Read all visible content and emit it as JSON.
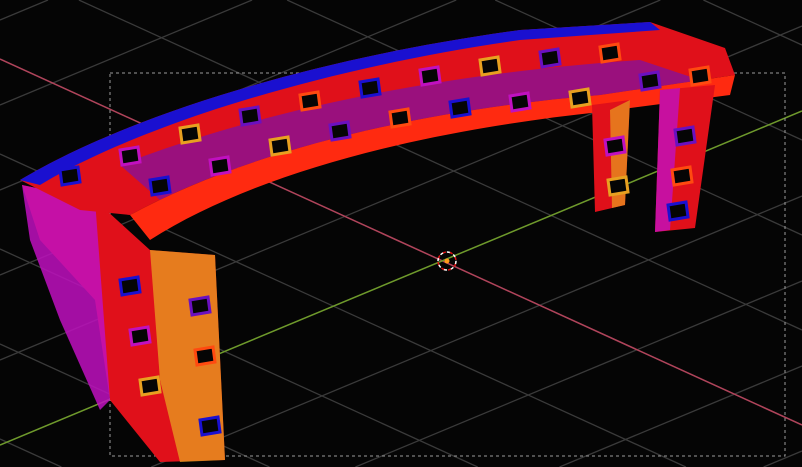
{
  "viewport": {
    "background": "#050505",
    "grid_color": "#3a3a3a",
    "x_axis_color": "#b0435a",
    "y_axis_color": "#6e9a2a",
    "camera_frame_color": "#9a9a9a",
    "cursor_center_color": "#ff9a1a"
  },
  "mesh": {
    "palette": [
      "#e0101a",
      "#1a10d0",
      "#c010c0",
      "#e8a020",
      "#6a10c0",
      "#ff4a10"
    ]
  }
}
